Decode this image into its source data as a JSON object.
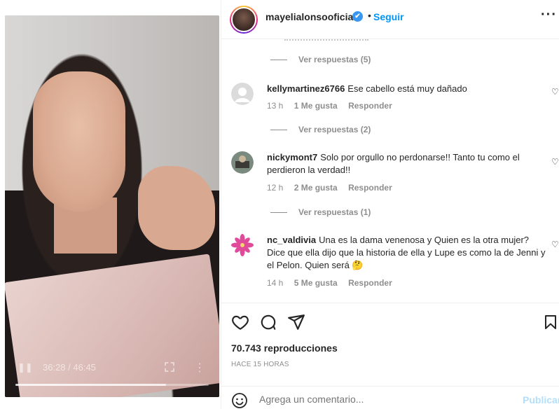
{
  "post": {
    "username": "mayelialonsooficial",
    "verified_mark": "✔",
    "dot": "•",
    "follow_label": "Seguir",
    "more_label": "···"
  },
  "video": {
    "time": "36:28 / 46:45",
    "progress_fraction": 0.78
  },
  "comments": {
    "top_replies": "Ver respuestas (5)",
    "items": [
      {
        "username": "kellymartinez6766",
        "text": "Ese cabello está muy dañado",
        "time": "13 h",
        "likes": "1 Me gusta",
        "reply": "Responder",
        "replies": "Ver respuestas (2)",
        "avatar_icon": "default-avatar-icon"
      },
      {
        "username": "nickymont7",
        "text": "Solo por orgullo no perdonarse!! Tanto tu como el perdieron la verdad!!",
        "time": "12 h",
        "likes": "2 Me gusta",
        "reply": "Responder",
        "replies": "Ver respuestas (1)",
        "avatar_icon": "photo-avatar-icon"
      },
      {
        "username": "nc_valdivia",
        "text": "Una es la dama venenosa y Quien es la otra mujer? Dice que ella dijo que la historia de ella y Lupe es como la de Jenni y el Pelon. Quien será 🤔",
        "time": "14 h",
        "likes": "5 Me gusta",
        "reply": "Responder",
        "avatar_icon": "flower-avatar-icon"
      }
    ]
  },
  "stats": {
    "views": "70.743 reproducciones",
    "posted": "HACE 15 HORAS"
  },
  "composer": {
    "placeholder": "Agrega un comentario...",
    "publish_label": "Publicar"
  },
  "colors": {
    "accent": "#0095f6",
    "muted": "#8e8e8e",
    "text": "#262626",
    "publish_disabled": "#b2dffc"
  }
}
